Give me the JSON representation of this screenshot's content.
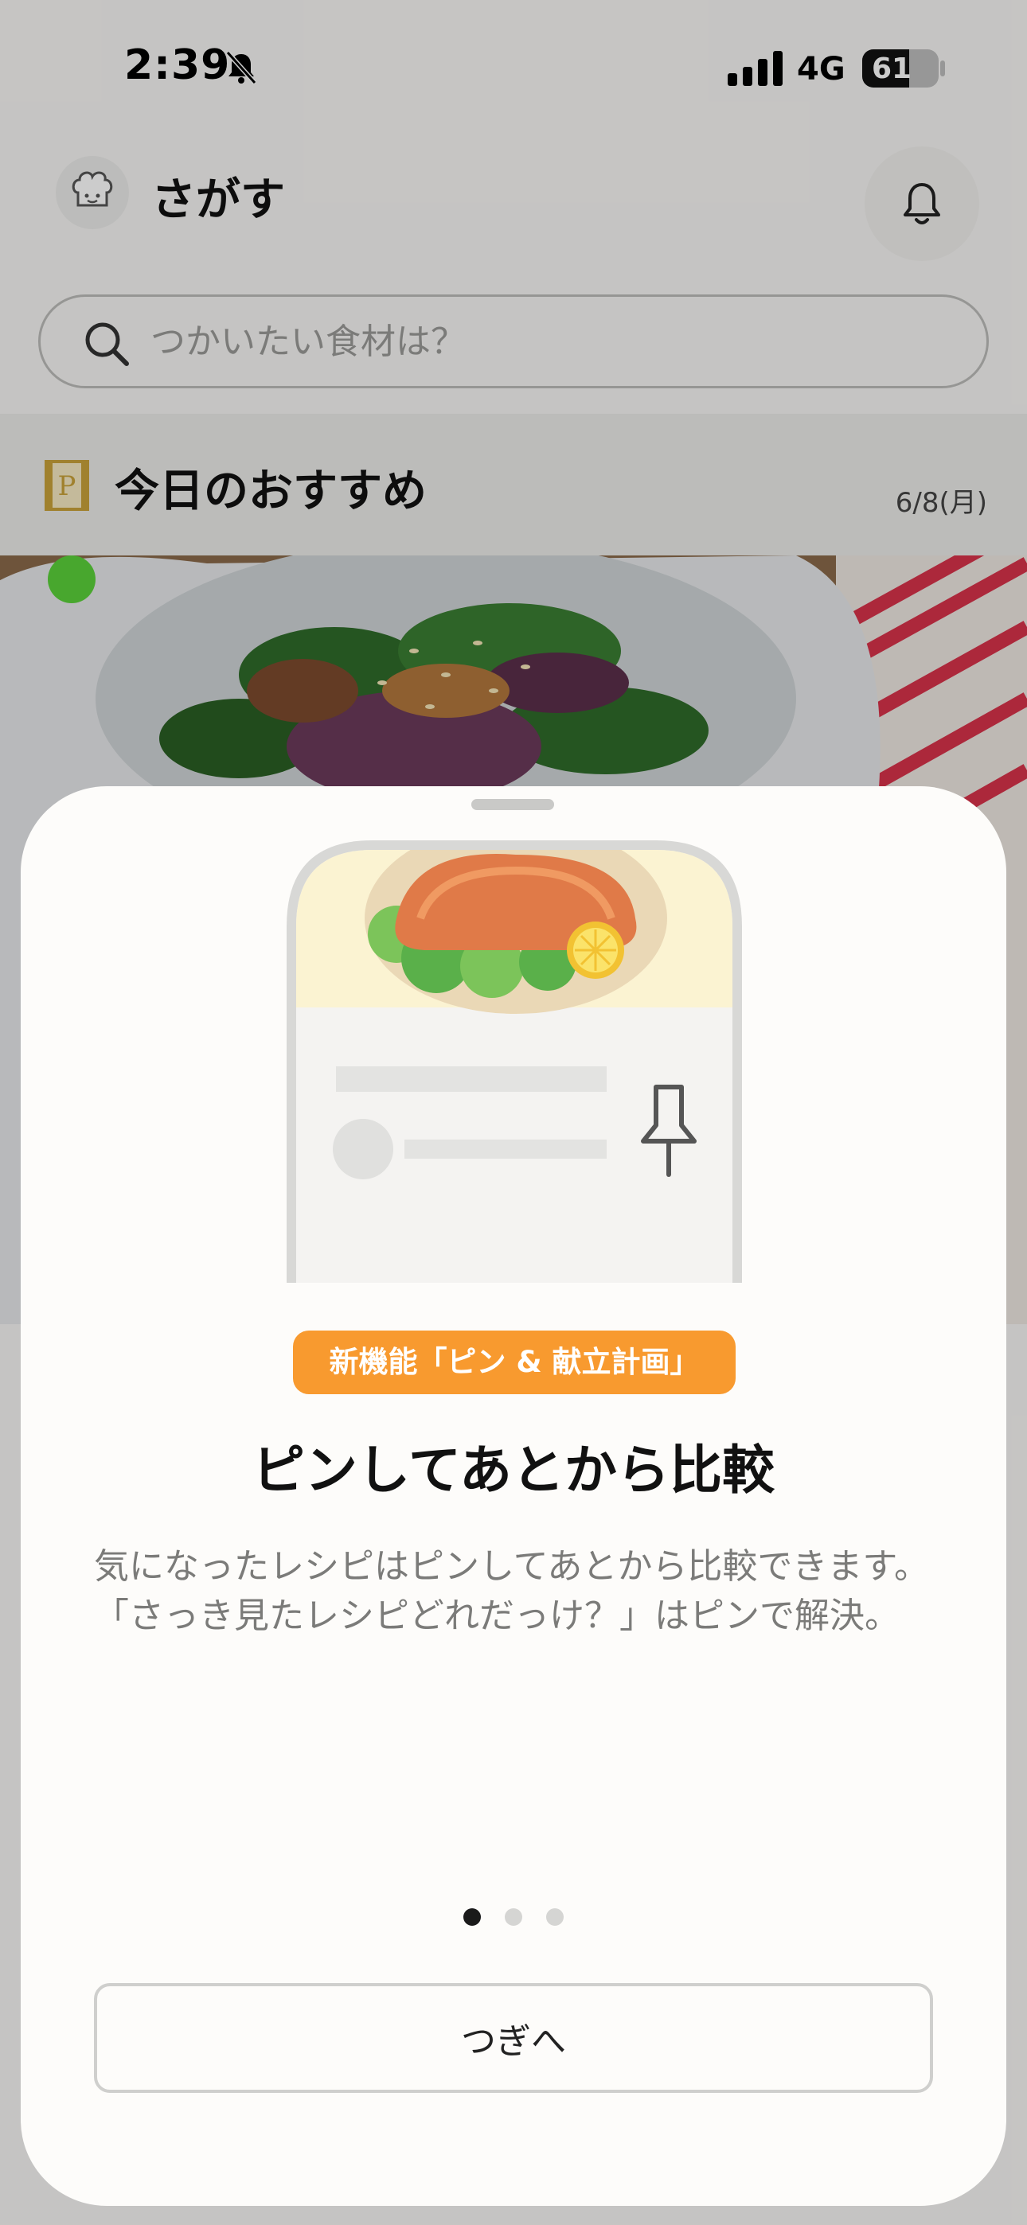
{
  "status_bar": {
    "time": "2:39",
    "network": "4G",
    "battery": "61",
    "battery_level": 0.61
  },
  "header": {
    "title": "さがす"
  },
  "search": {
    "placeholder": "つかいたい食材は？"
  },
  "section": {
    "title": "今日のおすすめ",
    "date": "6/8(月)",
    "badge_letter": "P"
  },
  "sheet": {
    "feature_tag": "新機能「ピン & 献立計画」",
    "title": "ピンしてあとから比較",
    "description": "気になったレシピはピンしてあとから比較できます。「さっき見たレシピどれだっけ？」はピンで解決。",
    "page_count": 3,
    "current_page": 1,
    "next_label": "つぎへ"
  },
  "colors": {
    "accent": "#f89a2f",
    "badge_gold": "#c9a23a"
  },
  "icons": [
    "bell-off-icon",
    "signal-icon",
    "battery-icon",
    "chef-icon",
    "bell-icon",
    "search-icon",
    "bookmark-badge-icon",
    "pin-icon"
  ]
}
